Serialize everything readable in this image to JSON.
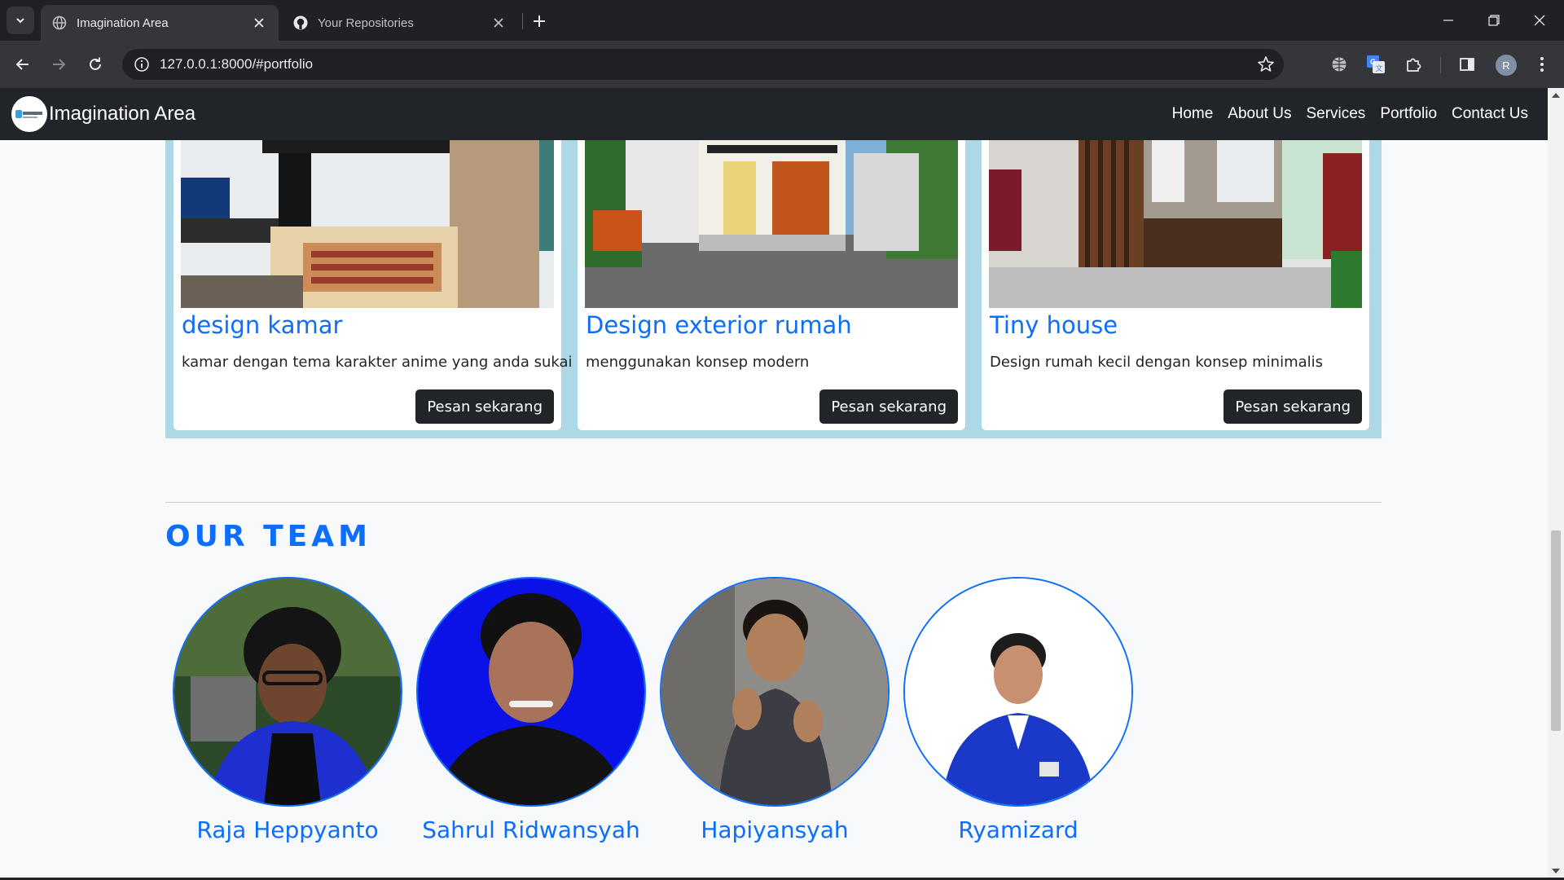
{
  "browser": {
    "tabs": [
      {
        "title": "Imagination Area",
        "icon": "globe-icon",
        "active": true
      },
      {
        "title": "Your Repositories",
        "icon": "github-icon",
        "active": false
      }
    ],
    "url": "127.0.0.1:8000/#portfolio",
    "profile_initial": "R"
  },
  "navbar": {
    "brand": "Imagination Area",
    "links": [
      "Home",
      "About Us",
      "Services",
      "Portfolio",
      "Contact Us"
    ]
  },
  "portfolio": {
    "cards": [
      {
        "title": "design kamar",
        "description": "kamar dengan tema karakter anime yang anda sukai",
        "button": "Pesan sekarang",
        "image": "anime-bedroom-render"
      },
      {
        "title": "Design exterior rumah",
        "description": "menggunakan konsep modern",
        "button": "Pesan sekarang",
        "image": "modern-house-exterior-render"
      },
      {
        "title": "Tiny house",
        "description": "Design rumah kecil dengan konsep minimalis",
        "button": "Pesan sekarang",
        "image": "tiny-house-render"
      }
    ]
  },
  "team": {
    "heading": "OUR TEAM",
    "members": [
      {
        "name": "Raja Heppyanto",
        "photo": "member-photo"
      },
      {
        "name": "Sahrul Ridwansyah",
        "photo": "member-photo"
      },
      {
        "name": "Hapiyansyah",
        "photo": "member-photo"
      },
      {
        "name": "Ryamizard",
        "photo": "member-photo"
      }
    ]
  },
  "colors": {
    "accent": "#0d6efd",
    "navbar": "#212529",
    "portfolio_band": "#add8e6",
    "page_bg": "#f8f9fa"
  }
}
